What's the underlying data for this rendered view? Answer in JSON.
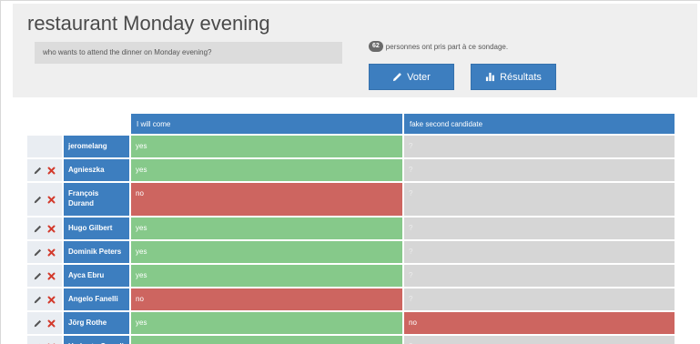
{
  "poll": {
    "title": "restaurant Monday evening",
    "description": "who wants to attend the dinner on Monday evening?",
    "participant_count": "62",
    "participants_text": "personnes ont pris part à ce sondage."
  },
  "buttons": {
    "vote_label": "Voter",
    "results_label": "Résultats"
  },
  "table": {
    "columns": [
      "I will come",
      "fake second candidate"
    ],
    "rows": [
      {
        "name": "jeromelang",
        "answers": [
          "yes",
          "?"
        ],
        "editable": false
      },
      {
        "name": "Agnieszka",
        "answers": [
          "yes",
          "?"
        ],
        "editable": true
      },
      {
        "name": "François Durand",
        "answers": [
          "no",
          "?"
        ],
        "editable": true
      },
      {
        "name": "Hugo Gilbert",
        "answers": [
          "yes",
          "?"
        ],
        "editable": true
      },
      {
        "name": "Dominik Peters",
        "answers": [
          "yes",
          "?"
        ],
        "editable": true
      },
      {
        "name": "Ayca Ebru",
        "answers": [
          "yes",
          "?"
        ],
        "editable": true
      },
      {
        "name": "Angelo Fanelli",
        "answers": [
          "no",
          "?"
        ],
        "editable": true
      },
      {
        "name": "Jörg Rothe",
        "answers": [
          "yes",
          "no"
        ],
        "editable": true
      },
      {
        "name": "Umberto Grandi",
        "answers": [
          "yes",
          "?"
        ],
        "editable": true
      }
    ]
  },
  "colors": {
    "primary": "#3d7ebf",
    "yes": "#86c98a",
    "no": "#cd6560",
    "unknown": "#d6d6d6",
    "delete": "#d33a2c"
  },
  "icons": {
    "edit": "pencil-icon",
    "delete": "close-icon",
    "vote": "pencil-icon",
    "results": "bar-chart-icon"
  }
}
